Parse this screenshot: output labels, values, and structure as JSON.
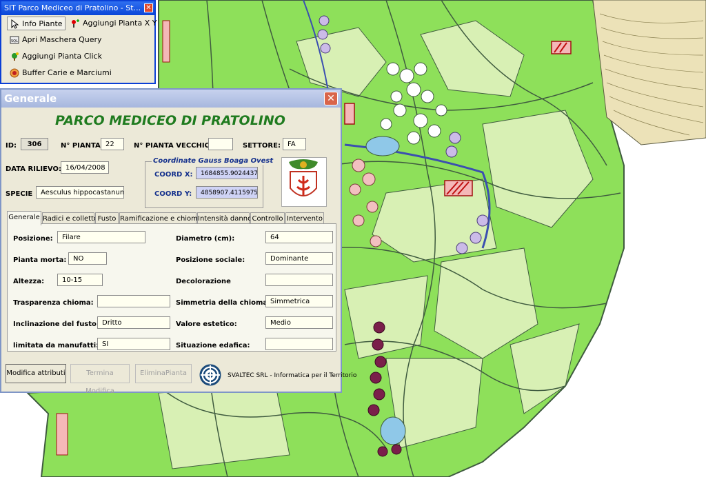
{
  "colors": {
    "map_green": "#8ee05a",
    "map_light": "#d8f0b4",
    "map_line": "#3f5b3f",
    "title_green": "#1f7b1f",
    "coord_blue": "#cfd3f5"
  },
  "toolbar": {
    "title": "SIT Parco Mediceo di Pratolino - St...",
    "close_glyph": "✕",
    "buttons": [
      {
        "label": "Info Piante",
        "icon": "pointer-icon"
      },
      {
        "label": "Aggiungi Pianta X Y",
        "icon": "add-pin-icon"
      },
      {
        "label": "Apri Maschera Query",
        "icon": "sql-icon"
      },
      {
        "label": "Aggiungi Pianta Click",
        "icon": "plant-click-icon"
      },
      {
        "label": "Buffer Carie e Marciumi",
        "icon": "buffer-icon"
      }
    ],
    "sql_text": "SQL"
  },
  "dialog": {
    "title": "Generale",
    "close_glyph": "✕",
    "heading": "PARCO MEDICEO DI PRATOLINO",
    "id_label": "ID:",
    "id_value": "306",
    "npianta_label": "N° PIANTA:",
    "npianta_value": "22",
    "npianta_old_label": "N° PIANTA VECCHIO:",
    "npianta_old_value": "",
    "settore_label": "SETTORE:",
    "settore_value": "FA",
    "data_label": "DATA RILIEVO:",
    "data_value": "16/04/2008",
    "specie_label": "SPECIE",
    "specie_value": "Aesculus hippocastanum",
    "coord_title": "Coordinate Gauss Boaga Ovest",
    "coordx_label": "COORD X:",
    "coordx_value": "1684855.9024437",
    "coordy_label": "COORD Y:",
    "coordy_value": "4858907.4115975",
    "tabs": [
      "Generale",
      "Radici e colletto",
      "Fusto",
      "Ramificazione e chioma",
      "Intensità danno",
      "Controllo",
      "Intervento"
    ],
    "fields_left": [
      {
        "label": "Posizione:",
        "value": "Filare"
      },
      {
        "label": "Pianta morta:",
        "value": "NO"
      },
      {
        "label": "Altezza:",
        "value": "10-15"
      },
      {
        "label": "Trasparenza chioma:",
        "value": ""
      },
      {
        "label": "Inclinazione del fusto:",
        "value": "Dritto"
      },
      {
        "label": "limitata da manufatti:",
        "value": "SI"
      }
    ],
    "fields_right": [
      {
        "label": "Diametro (cm):",
        "value": "64"
      },
      {
        "label": "Posizione sociale:",
        "value": "Dominante"
      },
      {
        "label": "Decolorazione",
        "value": ""
      },
      {
        "label": "Simmetria della chioma:",
        "value": "Simmetrica"
      },
      {
        "label": "Valore estetico:",
        "value": "Medio"
      },
      {
        "label": "Situazione edafica:",
        "value": ""
      }
    ],
    "btn_modifica": "Modifica attributi",
    "btn_termina": "Termina Modifica",
    "btn_elimina": "EliminaPianta",
    "footer": "SVALTEC SRL - Informatica per il Territorio"
  }
}
